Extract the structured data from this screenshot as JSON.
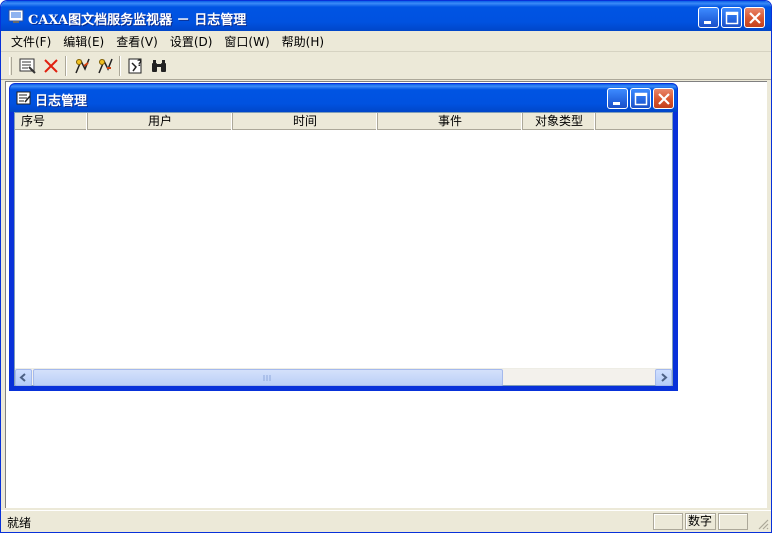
{
  "app": {
    "title": "CAXA图文档服务监视器 － 日志管理",
    "icon": "app-monitor-icon"
  },
  "window_controls": [
    "minimize-icon",
    "maximize-icon",
    "close-icon"
  ],
  "menu": [
    {
      "label": "文件(F)"
    },
    {
      "label": "编辑(E)"
    },
    {
      "label": "查看(V)"
    },
    {
      "label": "设置(D)"
    },
    {
      "label": "窗口(W)"
    },
    {
      "label": "帮助(H)"
    }
  ],
  "toolbar": {
    "groups": [
      [
        "log-view-icon",
        "delete-icon"
      ],
      [
        "filter-user-icon",
        "filter-object-icon"
      ],
      [
        "refresh-help-icon",
        "find-binoculars-icon"
      ]
    ]
  },
  "child_window": {
    "title": "日志管理",
    "icon": "log-window-icon",
    "columns": [
      "序号",
      "用户",
      "时间",
      "事件",
      "对象类型"
    ],
    "rows": []
  },
  "status": {
    "text": "就绪",
    "num_indicator": "数字"
  },
  "colors": {
    "title_blue": "#0054e3",
    "face": "#ece9d8",
    "close_red": "#d9562f"
  }
}
